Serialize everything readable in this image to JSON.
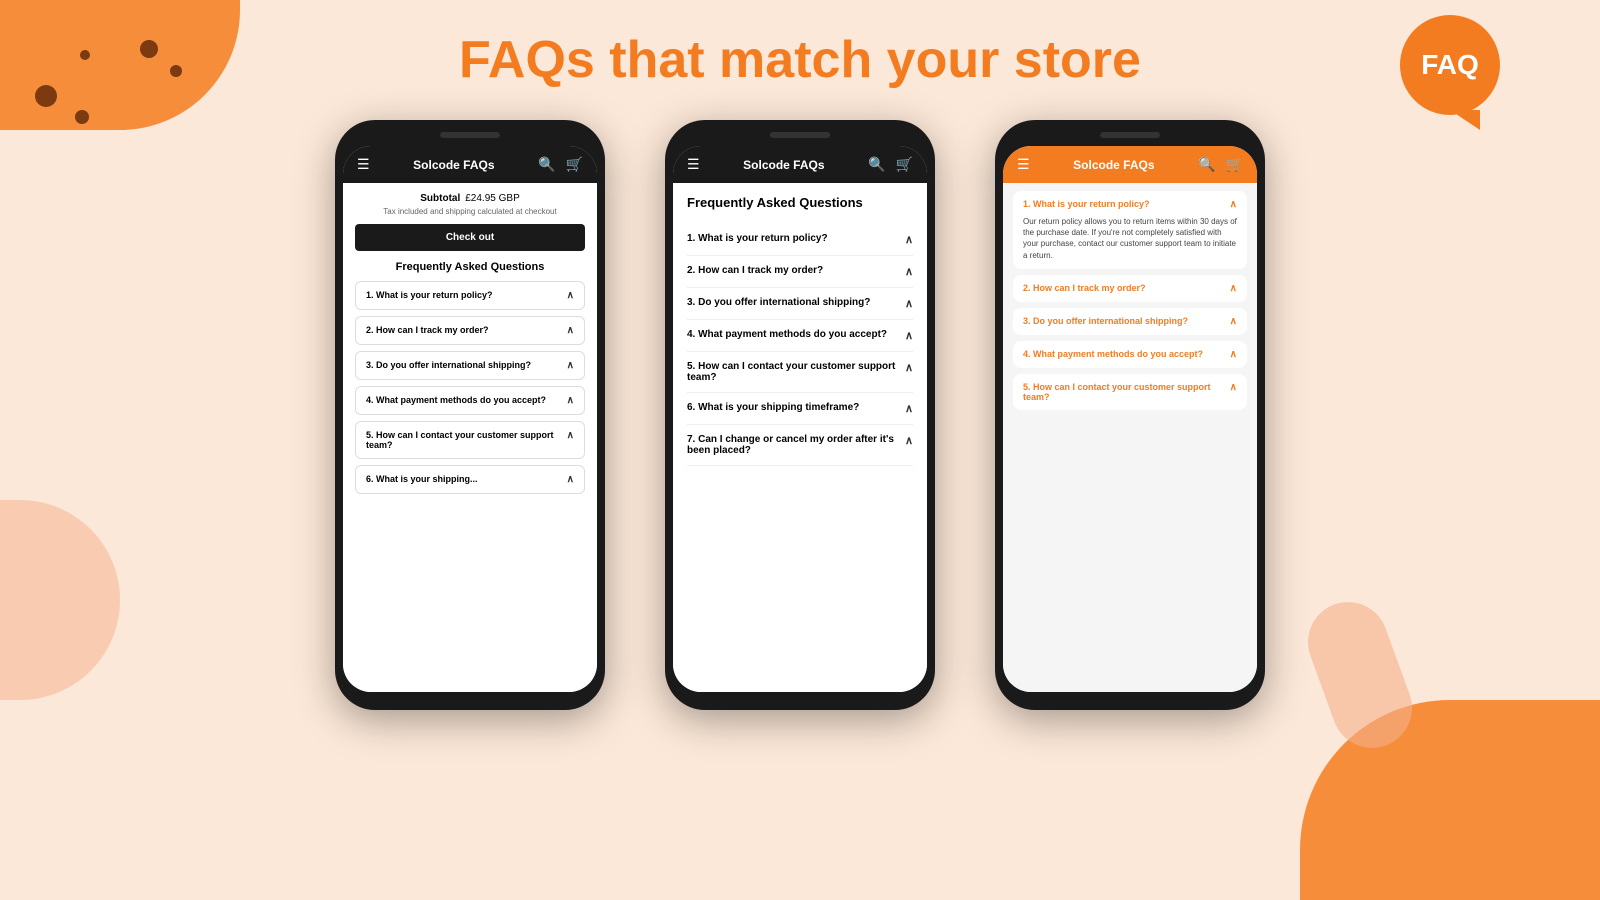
{
  "page": {
    "title": "FAQs that match your store",
    "background_color": "#fce8d8",
    "accent_color": "#f47c20"
  },
  "faq_bubble": {
    "text": "FAQ"
  },
  "phone1": {
    "nav": {
      "title": "Solcode FAQs"
    },
    "subtotal_label": "Subtotal",
    "subtotal_amount": "£24.95 GBP",
    "subtotal_note": "Tax included and shipping calculated at checkout",
    "checkout_button": "Check out",
    "faq_section_title": "Frequently Asked Questions",
    "faq_items": [
      {
        "text": "1. What is your return policy?",
        "open": true
      },
      {
        "text": "2. How can I track my order?",
        "open": true
      },
      {
        "text": "3. Do you offer international shipping?",
        "open": true
      },
      {
        "text": "4. What payment methods do you accept?",
        "open": true
      },
      {
        "text": "5. How can I contact your customer support team?",
        "open": true
      },
      {
        "text": "6. What is your shipping...",
        "open": true
      }
    ]
  },
  "phone2": {
    "nav": {
      "title": "Solcode FAQs"
    },
    "faq_title": "Frequently Asked Questions",
    "faq_items": [
      {
        "text": "1. What is your return policy?"
      },
      {
        "text": "2. How can I track my order?"
      },
      {
        "text": "3. Do you offer international shipping?"
      },
      {
        "text": "4. What payment methods do you accept?"
      },
      {
        "text": "5. How can I contact your customer support team?"
      },
      {
        "text": "6. What is your shipping timeframe?"
      },
      {
        "text": "7. Can I change or cancel my order after it's been placed?"
      }
    ]
  },
  "phone3": {
    "nav": {
      "title": "Solcode FAQs"
    },
    "faq_items": [
      {
        "question": "1. What is your return policy?",
        "answer": "Our return policy allows you to return items within 30 days of the purchase date. If you're not completely satisfied with your purchase, contact our customer support team to initiate a return.",
        "open": true
      },
      {
        "question": "2. How can I track my order?",
        "open": true,
        "answer": ""
      },
      {
        "question": "3. Do you offer international shipping?",
        "open": true,
        "answer": ""
      },
      {
        "question": "4. What payment methods do you accept?",
        "open": true,
        "answer": ""
      },
      {
        "question": "5. How can I contact your customer support team?",
        "open": true,
        "answer": ""
      }
    ]
  }
}
